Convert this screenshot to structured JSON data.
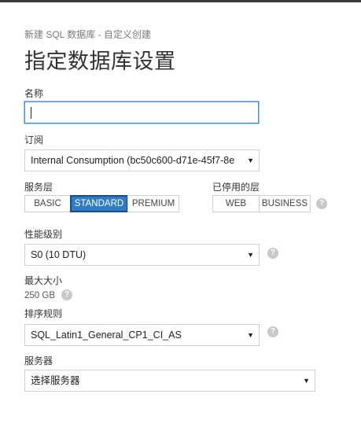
{
  "header": {
    "breadcrumb": "新建 SQL 数据库 - 自定义创建",
    "title": "指定数据库设置"
  },
  "form": {
    "name": {
      "label": "名称",
      "value": ""
    },
    "subscription": {
      "label": "订阅",
      "value": "Internal Consumption (bc50c600-d71e-45f7-8e"
    },
    "service_tier": {
      "label": "服务层",
      "options": [
        "BASIC",
        "STANDARD",
        "PREMIUM"
      ],
      "selected": "STANDARD"
    },
    "disabled_tier": {
      "label": "已停用的层",
      "options": [
        "WEB",
        "BUSINESS"
      ]
    },
    "performance": {
      "label": "性能级别",
      "value": "S0 (10 DTU)"
    },
    "max_size": {
      "label": "最大大小",
      "value": "250 GB"
    },
    "collation": {
      "label": "排序规则",
      "value": "SQL_Latin1_General_CP1_CI_AS"
    },
    "server": {
      "label": "服务器",
      "value": "选择服务器"
    }
  },
  "icons": {
    "dropdown": "▼",
    "help": "?"
  },
  "colors": {
    "accent": "#2f7cc4",
    "focus_border": "#4a8fd4"
  }
}
